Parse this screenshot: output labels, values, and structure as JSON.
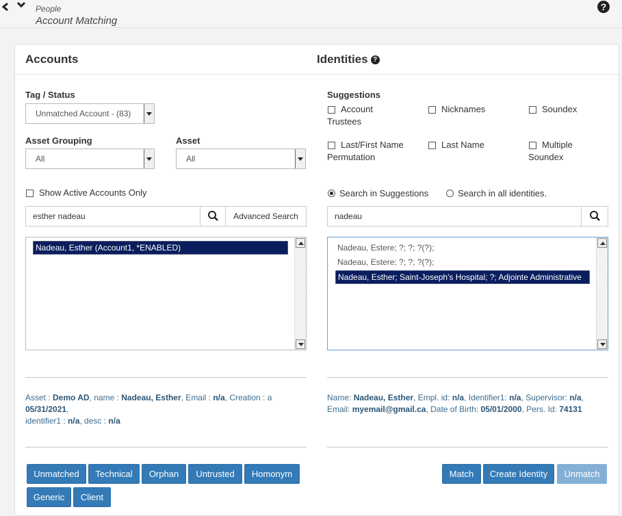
{
  "header": {
    "breadcrumb_parent": "People",
    "title": "Account Matching",
    "help_icon": "question-circle-icon"
  },
  "accounts": {
    "heading": "Accounts",
    "tag_status_label": "Tag / Status",
    "tag_status_value": "Unmatched Account - (83)",
    "asset_grouping_label": "Asset Grouping",
    "asset_grouping_value": "All",
    "asset_label": "Asset",
    "asset_value": "All",
    "show_active_label": "Show Active Accounts Only",
    "show_active_checked": false,
    "search_value": "esther nadeau",
    "advanced_search_label": "Advanced Search",
    "list_items": [
      {
        "text": "Nadeau, Esther (Account1, *ENABLED)",
        "selected": true
      }
    ],
    "details": {
      "asset_key": "Asset : ",
      "asset_val": "Demo AD",
      "name_key": ", name : ",
      "name_val": "Nadeau, Esther",
      "email_key": ", Email : ",
      "email_val": "n/a",
      "creation_key": ", Creation : a",
      "creation_val": "05/31/2021",
      "creation_tail": ",",
      "identifier_key": "identifier1 : ",
      "identifier_val": "n/a",
      "desc_key": ", desc : ",
      "desc_val": "n/a"
    },
    "buttons": [
      "Unmatched",
      "Technical",
      "Orphan",
      "Untrusted",
      "Homonym",
      "Generic",
      "Client"
    ]
  },
  "identities": {
    "heading": "Identities",
    "suggestions_label": "Suggestions",
    "suggestion_options": [
      {
        "label_line1": "Account",
        "label_line2": "Trustees",
        "checked": false
      },
      {
        "label_line1": "Nicknames",
        "label_line2": "",
        "checked": false
      },
      {
        "label_line1": "Soundex",
        "label_line2": "",
        "checked": false
      },
      {
        "label_line1": "Last/First Name",
        "label_line2": "Permutation",
        "checked": false
      },
      {
        "label_line1": "Last Name",
        "label_line2": "",
        "checked": false
      },
      {
        "label_line1": "Multiple",
        "label_line2": "Soundex",
        "checked": false
      }
    ],
    "search_scope_options": [
      {
        "label": "Search in Suggestions",
        "selected": true
      },
      {
        "label": "Search in all identities.",
        "selected": false
      }
    ],
    "search_value": "nadeau",
    "list_items": [
      {
        "text": "Nadeau, Estere; ?; ?; ?(?);",
        "selected": false
      },
      {
        "text": "Nadeau, Estere; ?; ?; ?(?);",
        "selected": false
      },
      {
        "text": "Nadeau, Esther; Saint-Joseph's Hospital; ?; Adjointe Administrative",
        "selected": true
      }
    ],
    "details": {
      "name_key": "Name: ",
      "name_val": "Nadeau, Esther",
      "empl_key": ", Empl. id: ",
      "empl_val": "n/a",
      "ident_key": ", Identifier1: ",
      "ident_val": "n/a",
      "sup_key": ", Supervisor: ",
      "sup_val": "n/a",
      "sup_tail": ",",
      "email_key": "Email: ",
      "email_val": "myemail@gmail.ca",
      "dob_key": ", Date of Birth: ",
      "dob_val": "05/01/2000",
      "pers_key": ", Pers. Id: ",
      "pers_val": "74131"
    },
    "buttons": {
      "match": "Match",
      "create_identity": "Create Identity",
      "unmatch": "Unmatch"
    }
  },
  "colors": {
    "primary_button": "#337ab7",
    "disabled_button": "#84b0d6",
    "selected_row": "#0a1e5e",
    "info_text": "#3c6b8c"
  }
}
